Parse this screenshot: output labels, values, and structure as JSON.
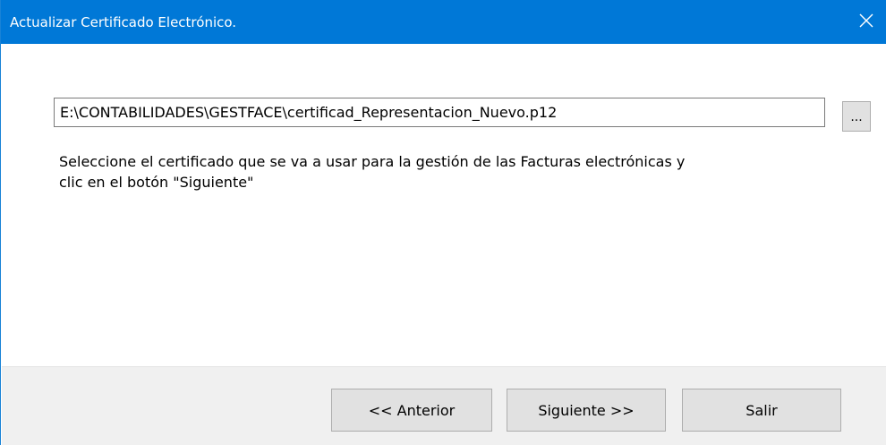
{
  "window": {
    "title": "Actualizar Certificado Electrónico."
  },
  "form": {
    "certificate_path": "E:\\CONTABILIDADES\\GESTFACE\\certificad_Representacion_Nuevo.p12",
    "browse_label": "...",
    "instruction_line1": "Seleccione el certificado que se va a usar para la gestión de las Facturas electrónicas y",
    "instruction_line2": "clic en el botón \"Siguiente\""
  },
  "footer": {
    "prev_label": "<< Anterior",
    "next_label": "Siguiente >>",
    "exit_label": "Salir"
  },
  "icons": {
    "close": "close-icon"
  },
  "colors": {
    "titlebar": "#0078d7",
    "footer": "#f0f0f0",
    "button": "#e1e1e1"
  }
}
